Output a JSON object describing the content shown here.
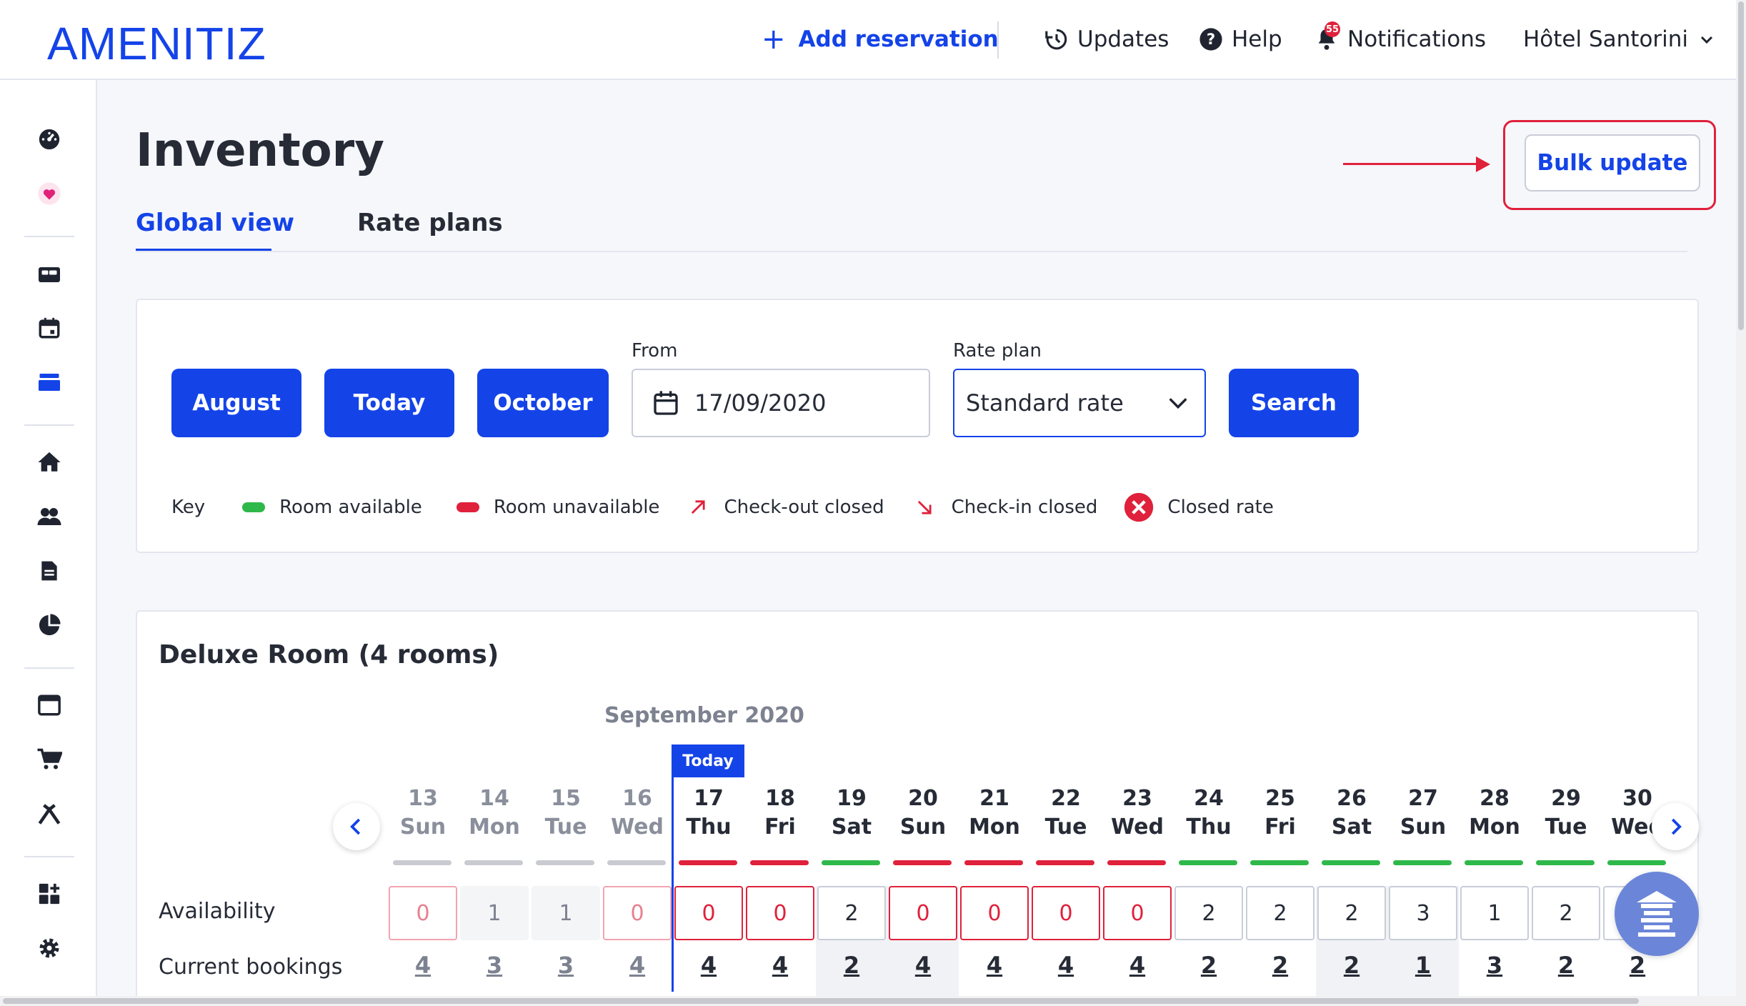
{
  "header": {
    "logo": "AMENITIZ",
    "add_reservation": "Add reservation",
    "updates": "Updates",
    "help": "Help",
    "notifications": "Notifications",
    "notifications_count": "55",
    "hotel_name": "Hôtel Santorini"
  },
  "sidebar": {
    "icons": [
      "dashboard-icon",
      "heart-icon",
      "bed-icon",
      "calendar-icon",
      "inventory-icon",
      "home-icon",
      "users-icon",
      "document-icon",
      "pie-chart-icon",
      "window-icon",
      "cart-icon",
      "tools-icon",
      "apps-icon",
      "gear-icon"
    ]
  },
  "page": {
    "title": "Inventory",
    "bulk_update": "Bulk update",
    "tabs": [
      {
        "label": "Global view",
        "active": true
      },
      {
        "label": "Rate plans",
        "active": false
      }
    ]
  },
  "filters": {
    "prev_month": "August",
    "today": "Today",
    "next_month": "October",
    "from_label": "From",
    "from_value": "17/09/2020",
    "rate_plan_label": "Rate plan",
    "rate_plan_value": "Standard rate",
    "search": "Search"
  },
  "key": {
    "label": "Key",
    "items": [
      {
        "label": "Room available",
        "color": "#2fb84a"
      },
      {
        "label": "Room unavailable",
        "color": "#e0213b"
      },
      {
        "label": "Check-out closed",
        "color": "#e0213b"
      },
      {
        "label": "Check-in closed",
        "color": "#e0213b"
      },
      {
        "label": "Closed rate",
        "color": "#e0213b"
      }
    ]
  },
  "room": {
    "title": "Deluxe Room (4 rooms)",
    "month": "September 2020",
    "today_tag": "Today",
    "availability_label": "Availability",
    "bookings_label": "Current bookings",
    "days": [
      {
        "num": "13",
        "name": "Sun",
        "past": true,
        "status": "none",
        "avail": "0",
        "book": "4",
        "weekend": false
      },
      {
        "num": "14",
        "name": "Mon",
        "past": true,
        "status": "none",
        "avail": "1",
        "book": "3",
        "weekend": false
      },
      {
        "num": "15",
        "name": "Tue",
        "past": true,
        "status": "none",
        "avail": "1",
        "book": "3",
        "weekend": false
      },
      {
        "num": "16",
        "name": "Wed",
        "past": true,
        "status": "none",
        "avail": "0",
        "book": "4",
        "weekend": false
      },
      {
        "num": "17",
        "name": "Thu",
        "past": false,
        "status": "unavailable",
        "avail": "0",
        "book": "4",
        "weekend": false
      },
      {
        "num": "18",
        "name": "Fri",
        "past": false,
        "status": "unavailable",
        "avail": "0",
        "book": "4",
        "weekend": false
      },
      {
        "num": "19",
        "name": "Sat",
        "past": false,
        "status": "available",
        "avail": "2",
        "book": "2",
        "weekend": true
      },
      {
        "num": "20",
        "name": "Sun",
        "past": false,
        "status": "unavailable",
        "avail": "0",
        "book": "4",
        "weekend": true
      },
      {
        "num": "21",
        "name": "Mon",
        "past": false,
        "status": "unavailable",
        "avail": "0",
        "book": "4",
        "weekend": false
      },
      {
        "num": "22",
        "name": "Tue",
        "past": false,
        "status": "unavailable",
        "avail": "0",
        "book": "4",
        "weekend": false
      },
      {
        "num": "23",
        "name": "Wed",
        "past": false,
        "status": "unavailable",
        "avail": "0",
        "book": "4",
        "weekend": false
      },
      {
        "num": "24",
        "name": "Thu",
        "past": false,
        "status": "available",
        "avail": "2",
        "book": "2",
        "weekend": false
      },
      {
        "num": "25",
        "name": "Fri",
        "past": false,
        "status": "available",
        "avail": "2",
        "book": "2",
        "weekend": false
      },
      {
        "num": "26",
        "name": "Sat",
        "past": false,
        "status": "available",
        "avail": "2",
        "book": "2",
        "weekend": true
      },
      {
        "num": "27",
        "name": "Sun",
        "past": false,
        "status": "available",
        "avail": "3",
        "book": "1",
        "weekend": true
      },
      {
        "num": "28",
        "name": "Mon",
        "past": false,
        "status": "available",
        "avail": "1",
        "book": "3",
        "weekend": false
      },
      {
        "num": "29",
        "name": "Tue",
        "past": false,
        "status": "available",
        "avail": "2",
        "book": "2",
        "weekend": false
      },
      {
        "num": "30",
        "name": "Wed",
        "past": false,
        "status": "available",
        "avail": "",
        "book": "2",
        "weekend": false
      }
    ]
  },
  "colors": {
    "accent": "#1443e8",
    "available": "#2fb84a",
    "unavailable": "#e0213b",
    "past_bar": "#c9cbd1"
  }
}
